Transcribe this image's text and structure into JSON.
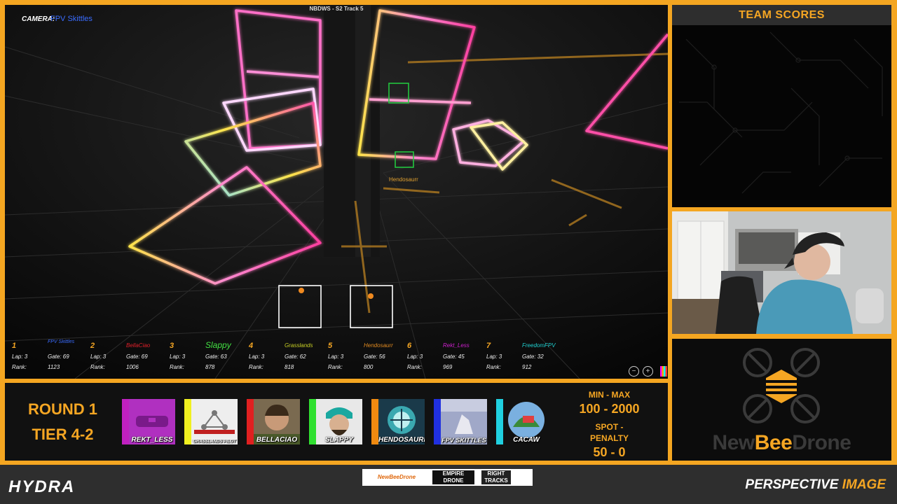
{
  "overlay": {
    "camera_label": "CAMERA:",
    "camera_pilot": "FPV Skittles",
    "track_title": "NBDWS - S2 Track 5",
    "pilot_tag": "Hendosaurr"
  },
  "race_stats": [
    {
      "pos": "1",
      "name": "FPV Skittles",
      "name_color": "#3a6cff",
      "lap": "Lap: 3",
      "gate": "Gate: 69",
      "rank_label": "Rank:",
      "rank": "1123"
    },
    {
      "pos": "2",
      "name": "BellaCiao",
      "name_color": "#e0202a",
      "lap": "Lap: 3",
      "gate": "Gate: 69",
      "rank_label": "Rank:",
      "rank": "1006"
    },
    {
      "pos": "3",
      "name": "Slappy",
      "name_color": "#42e042",
      "lap": "Lap: 3",
      "gate": "Gate: 63",
      "rank_label": "Rank:",
      "rank": "878"
    },
    {
      "pos": "4",
      "name": "Grasslands",
      "name_color": "#c8d024",
      "lap": "Lap: 3",
      "gate": "Gate: 62",
      "rank_label": "Rank:",
      "rank": "818"
    },
    {
      "pos": "5",
      "name": "Hendosaurr",
      "name_color": "#e08a20",
      "lap": "Lap: 3",
      "gate": "Gate: 56",
      "rank_label": "Rank:",
      "rank": "800"
    },
    {
      "pos": "6",
      "name": "Rekt_Less",
      "name_color": "#d020d0",
      "lap": "Lap: 3",
      "gate": "Gate: 45",
      "rank_label": "Rank:",
      "rank": "969"
    },
    {
      "pos": "7",
      "name": "FreedomFPV",
      "name_color": "#20d0d0",
      "lap": "Lap: 3",
      "gate": "Gate: 32",
      "rank_label": "Rank:",
      "rank": "912"
    }
  ],
  "controls": {
    "minus": "−",
    "plus": "+"
  },
  "team_scores": {
    "title": "TEAM SCORES"
  },
  "logo": {
    "part1": "New",
    "part2": "Bee",
    "part3": "Drone"
  },
  "round": {
    "line1": "ROUND 1",
    "line2": "TIER 4-2"
  },
  "pilots": [
    {
      "label": "REKT_LESS",
      "accent": "#c020c0",
      "bg": "#b030c0"
    },
    {
      "label": "GRASSLANDS PILOT",
      "accent": "#f0f020",
      "bg": "#eeeeee"
    },
    {
      "label": "BELLACIAO",
      "accent": "#e02020",
      "bg": "#7a6a50"
    },
    {
      "label": "SLAPPY",
      "accent": "#30e030",
      "bg": "#e8e8e8"
    },
    {
      "label": "HENDOSAURR",
      "accent": "#f08a10",
      "bg": "#1a3a4a"
    },
    {
      "label": "FPV SKITTLES",
      "accent": "#2030e0",
      "bg": "#a0a8c8"
    },
    {
      "label": "CACAW",
      "accent": "#20d0e0",
      "bg": "#3a6a3a"
    }
  ],
  "scoring": {
    "minmax_label": "MIN - MAX",
    "minmax_value": "100 - 2000",
    "spot_label": "SPOT - PENALTY",
    "spot_value": "50 - 0"
  },
  "footer": {
    "left_brand": "HYDRA",
    "sponsor1": "NewBeeDrone",
    "sponsor2": "EMPIRE DRONE",
    "sponsor3": "RIGHT TRACKS",
    "right_brand_a": "PERSPECTIVE",
    "right_brand_b": "IMAGE"
  }
}
